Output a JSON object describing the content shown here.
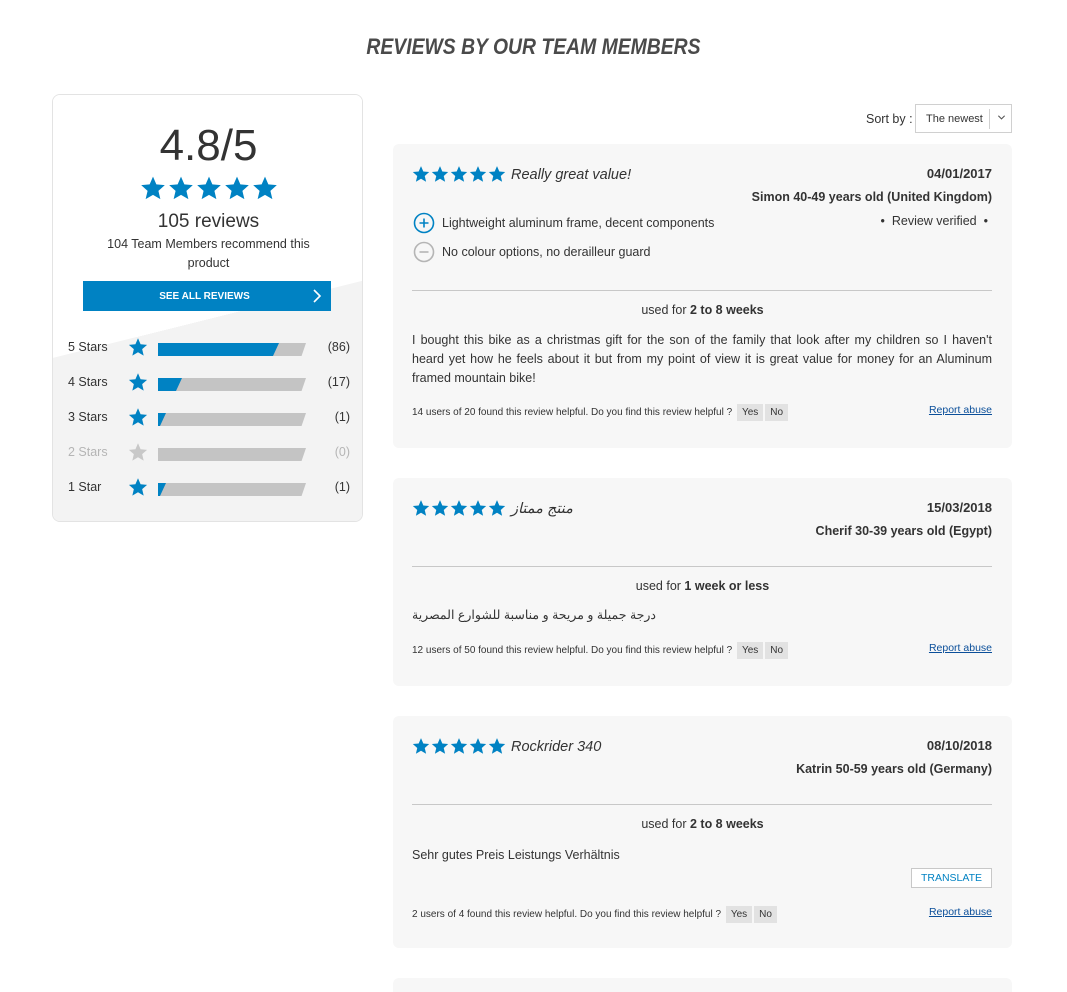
{
  "page_title": "REVIEWS BY OUR TEAM MEMBERS",
  "colors": {
    "accent": "#0082c3",
    "bar_bg": "#c4c4c4",
    "star_empty": "#c8c8c8",
    "card_bg": "#f7f7f7"
  },
  "summary": {
    "score": "4.8/5",
    "stars_filled": 5,
    "review_count": "105 reviews",
    "recommend": "104 Team Members recommend this product",
    "see_all_label": "SEE ALL REVIEWS",
    "distribution": [
      {
        "label": "5 Stars",
        "count": "(86)",
        "value": 86,
        "empty": false
      },
      {
        "label": "4 Stars",
        "count": "(17)",
        "value": 17,
        "empty": false
      },
      {
        "label": "3 Stars",
        "count": "(1)",
        "value": 1,
        "empty": false
      },
      {
        "label": "2 Stars",
        "count": "(0)",
        "value": 0,
        "empty": true
      },
      {
        "label": "1 Star",
        "count": "(1)",
        "value": 1,
        "empty": false
      }
    ]
  },
  "sort": {
    "label": "Sort by :",
    "value": "The newest"
  },
  "reviews": [
    {
      "rating": 5,
      "title": "Really great value!",
      "date": "04/01/2017",
      "author": "Simon 40-49 years old (United Kingdom)",
      "verified": "Review verified",
      "pro": "Lightweight aluminum frame, decent components",
      "con": "No colour options, no derailleur guard",
      "used_prefix": "used for ",
      "used_value": "2 to 8 weeks",
      "body": "I bought this bike as a christmas gift for the son of the family that look after my children so I haven't heard yet how he feels about it but from my point of view it is great value for money for an Aluminum framed mountain bike!",
      "helpful_text": "14 users of 20 found this review helpful. Do you find this review helpful ?",
      "yes": "Yes",
      "no": "No",
      "abuse": "Report abuse"
    },
    {
      "rating": 5,
      "title": "منتج ممتاز",
      "date": "15/03/2018",
      "author": "Cherif 30-39 years old (Egypt)",
      "used_prefix": "used for ",
      "used_value": "1 week or less",
      "body": "درجة جميلة و مريحة و مناسبة للشوارع المصرية",
      "helpful_text": "12 users of 50 found this review helpful. Do you find this review helpful ?",
      "yes": "Yes",
      "no": "No",
      "abuse": "Report abuse"
    },
    {
      "rating": 5,
      "title": "Rockrider 340",
      "date": "08/10/2018",
      "author": "Katrin 50-59 years old (Germany)",
      "used_prefix": "used for ",
      "used_value": "2 to 8 weeks",
      "body": "Sehr gutes Preis Leistungs Verhältnis",
      "translate": "TRANSLATE",
      "helpful_text": "2 users of 4 found this review helpful. Do you find this review helpful ?",
      "yes": "Yes",
      "no": "No",
      "abuse": "Report abuse"
    }
  ]
}
